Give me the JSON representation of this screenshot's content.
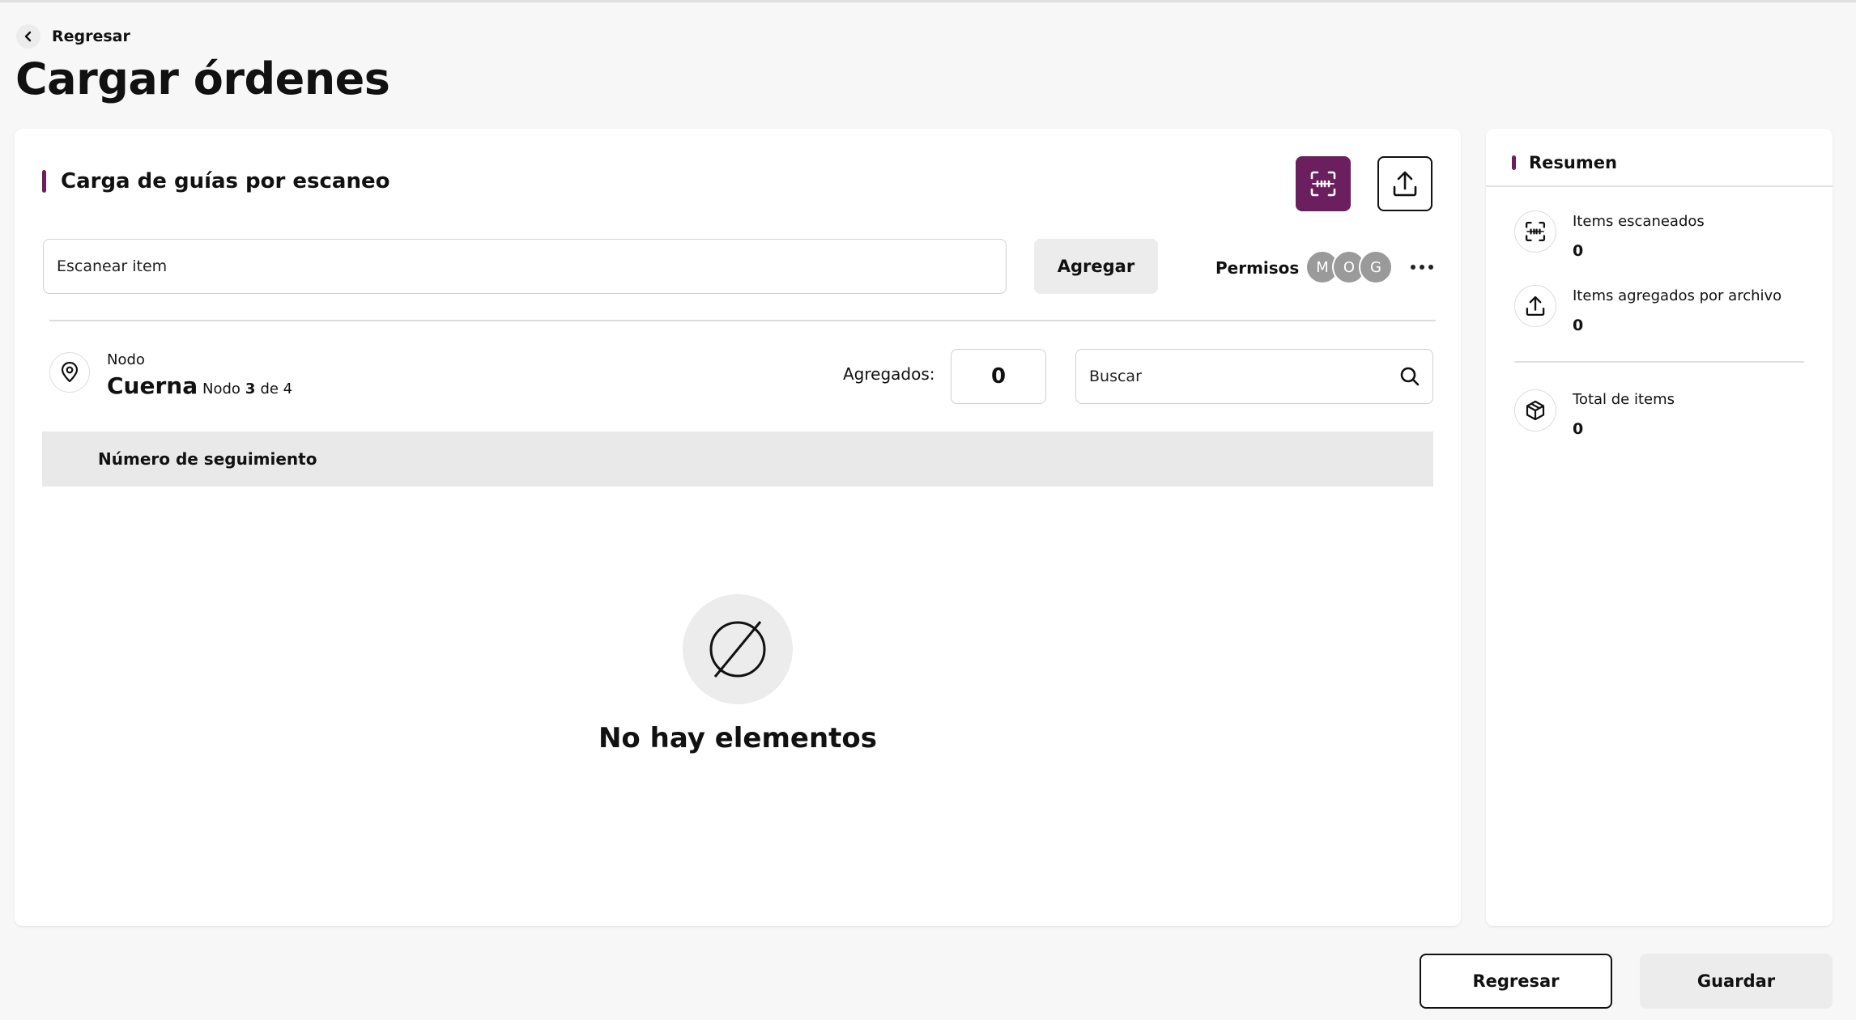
{
  "header": {
    "back_label": "Regresar",
    "title": "Cargar órdenes"
  },
  "main": {
    "section_title": "Carga de guías por escaneo",
    "scan_placeholder": "Escanear item",
    "add_label": "Agregar",
    "permissions_label": "Permisos",
    "avatars": [
      "M",
      "O",
      "G"
    ],
    "node": {
      "label": "Nodo",
      "name": "Cuerna",
      "count_prefix": "Nodo",
      "current": "3",
      "count_suffix": "de 4"
    },
    "added_label": "Agregados:",
    "added_value": "0",
    "search_placeholder": "Buscar",
    "table": {
      "columns": [
        "Número de seguimiento"
      ]
    },
    "empty_text": "No hay elementos"
  },
  "summary": {
    "title": "Resumen",
    "items": [
      {
        "label": "Items escaneados",
        "value": "0",
        "icon": "scan-icon"
      },
      {
        "label": "Items agregados por archivo",
        "value": "0",
        "icon": "upload-icon"
      },
      {
        "label": "Total de items",
        "value": "0",
        "icon": "box-icon"
      }
    ]
  },
  "footer": {
    "back_label": "Regresar",
    "save_label": "Guardar"
  },
  "colors": {
    "accent": "#6b1f5e",
    "background": "#f7f7f7",
    "avatar": "#9a9a9a"
  }
}
